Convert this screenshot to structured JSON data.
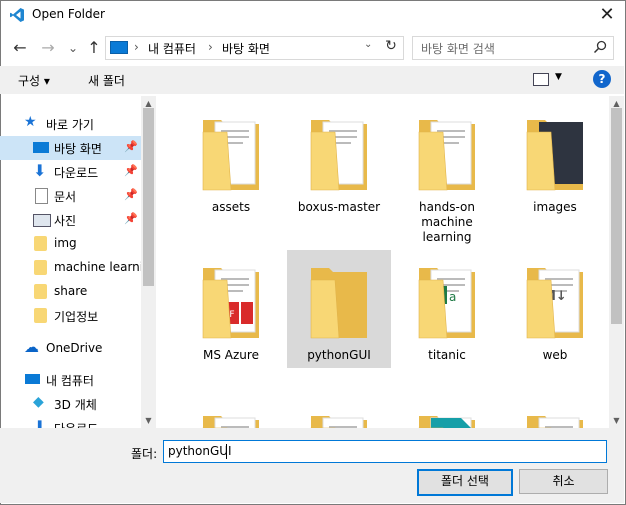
{
  "window": {
    "title": "Open Folder",
    "close": "✕"
  },
  "nav": {
    "back": "←",
    "forward": "→",
    "recent": "⌄",
    "up": "↑"
  },
  "address": {
    "segments": [
      "내 컴퓨터",
      "바탕 화면"
    ],
    "separator": "›"
  },
  "search": {
    "placeholder": "바탕 화면 검색"
  },
  "toolbar": {
    "organize": "구성 ▾",
    "new_folder": "새 폴더",
    "help": "?"
  },
  "sidebar": {
    "quick_access": "바로 가기",
    "items": [
      {
        "label": "바탕 화면",
        "pinned": true,
        "selected": true
      },
      {
        "label": "다운로드",
        "pinned": true
      },
      {
        "label": "문서",
        "pinned": true
      },
      {
        "label": "사진",
        "pinned": true
      },
      {
        "label": "img"
      },
      {
        "label": "machine learnin"
      },
      {
        "label": "share"
      },
      {
        "label": "기업정보"
      }
    ],
    "onedrive": "OneDrive",
    "this_pc": "내 컴퓨터",
    "pc_items": [
      "3D 개체",
      "다운로드"
    ]
  },
  "folders": [
    {
      "label": "assets"
    },
    {
      "label": "boxus-master"
    },
    {
      "label": "hands-on\nmachine\nlearning"
    },
    {
      "label": "images"
    },
    {
      "label": "MS Azure"
    },
    {
      "label": "pythonGUI",
      "selected": true
    },
    {
      "label": "titanic"
    },
    {
      "label": "web"
    },
    {
      "label": ""
    },
    {
      "label": ""
    },
    {
      "label": ""
    },
    {
      "label": ""
    }
  ],
  "footer": {
    "folder_label": "폴더:",
    "folder_value": "pythonGUI",
    "select_button": "폴더 선택",
    "cancel_button": "취소"
  },
  "colors": {
    "accent": "#0078d7",
    "selection": "#cce4f7",
    "folder": "#f8d775"
  }
}
